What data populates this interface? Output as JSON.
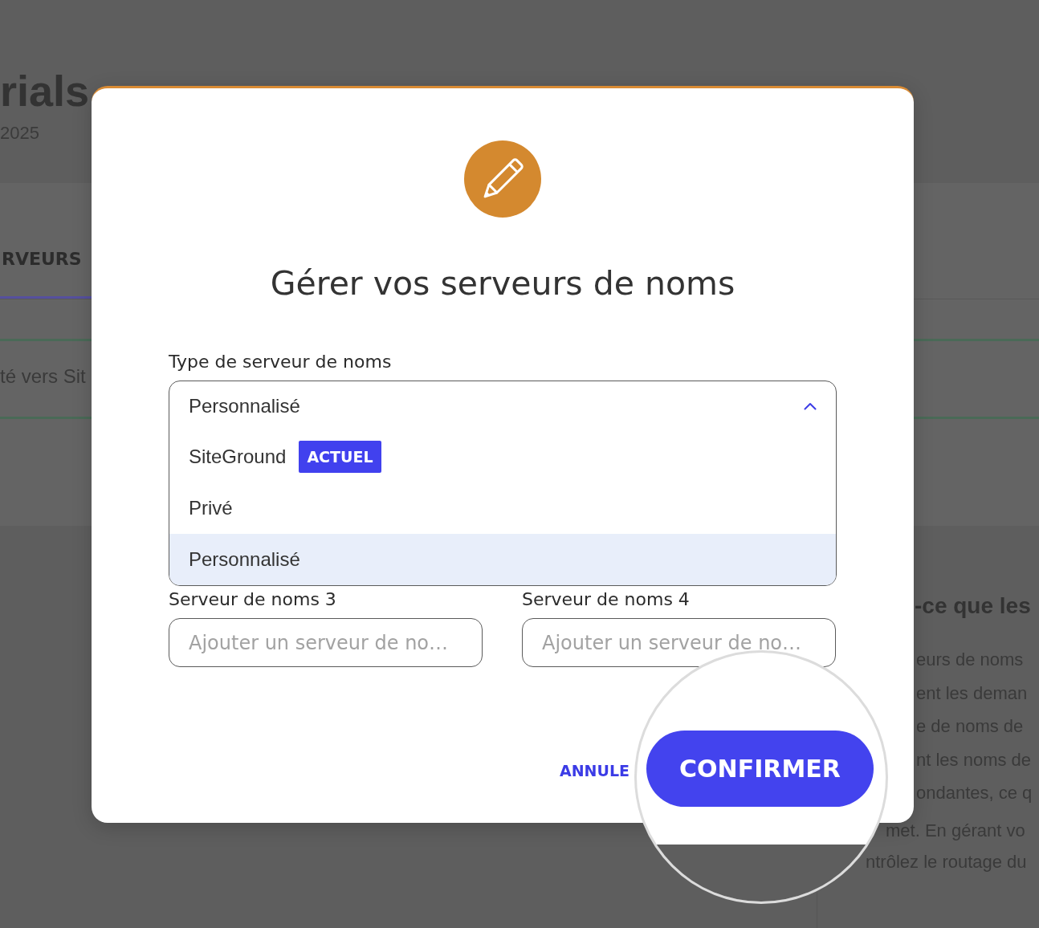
{
  "background_page": {
    "site_title": "rials",
    "date": "2025",
    "tabs": [
      {
        "label": "RVEURS",
        "selected": true
      }
    ],
    "notice": {
      "text": "té vers Sit"
    },
    "aside": {
      "heading": "-ce que les",
      "lines": [
        "eurs de noms",
        "ent les deman",
        "e de noms de",
        "nt les noms de",
        "ondantes, ce q",
        "met. En gérant vo",
        "ntrôlez le routage du"
      ]
    }
  },
  "dialog": {
    "title": "Gérer vos serveurs de noms",
    "type_field": {
      "label": "Type de serveur de noms",
      "value": "Personnalisé",
      "expanded": true,
      "options": [
        {
          "label": "SiteGround",
          "badge": "ACTUEL",
          "selected": false
        },
        {
          "label": "Privé",
          "selected": false
        },
        {
          "label": "Personnalisé",
          "selected": true
        }
      ]
    },
    "fields": [
      {
        "label": "Serveur de noms 3",
        "placeholder": "Ajouter un serveur de no…"
      },
      {
        "label": "Serveur de noms 4",
        "placeholder": "Ajouter un serveur de no…"
      }
    ],
    "cancel_button": "ANNULE"
  },
  "magnifier": {
    "button": "CONFIRMER"
  }
}
